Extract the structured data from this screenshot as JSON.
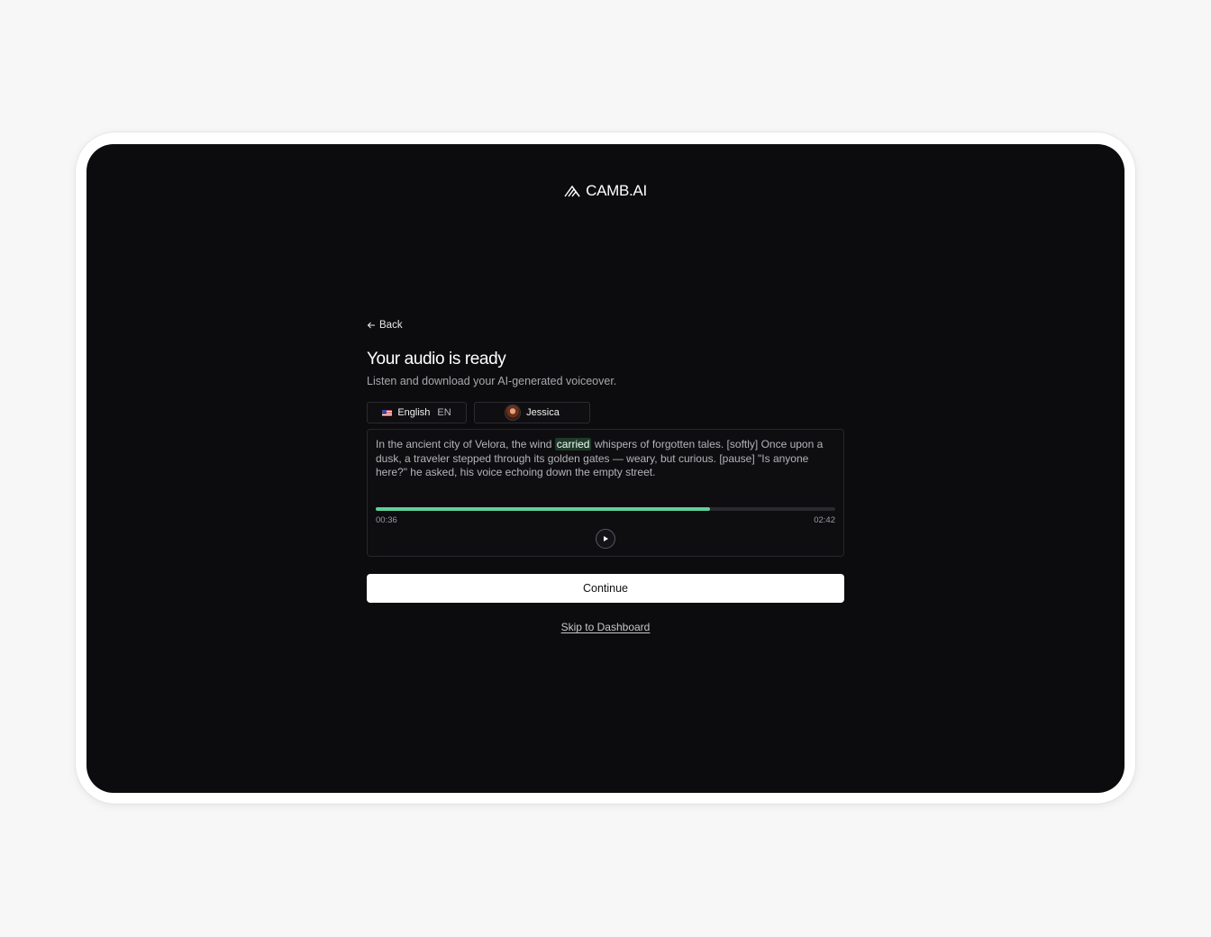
{
  "brand": {
    "name": "CAMB.AI"
  },
  "nav": {
    "back_label": "Back"
  },
  "header": {
    "title": "Your audio is ready",
    "subtitle": "Listen and download your AI-generated voiceover."
  },
  "language": {
    "flag": "us-flag-icon",
    "name": "English",
    "code": "EN"
  },
  "voice": {
    "name": "Jessica"
  },
  "transcript": {
    "before": "In the ancient city of Velora, the wind ",
    "highlight": "carried",
    "after": " whispers of forgotten tales. [softly] Once upon a dusk, a traveler stepped through its golden gates — weary, but curious. [pause] \"Is anyone here?\" he asked, his voice echoing down the empty street."
  },
  "player": {
    "current_time": "00:36",
    "total_time": "02:42",
    "progress_fraction": 0.727,
    "accent_color": "#5fd09a"
  },
  "actions": {
    "continue_label": "Continue",
    "skip_label": "Skip to Dashboard"
  }
}
